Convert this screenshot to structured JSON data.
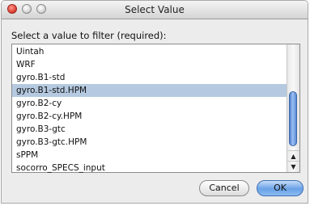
{
  "window": {
    "title": "Select Value"
  },
  "prompt": "Select a value to filter (required):",
  "list": {
    "items": [
      "Uintah",
      "WRF",
      "gyro.B1-std",
      "gyro.B1-std.HPM",
      "gyro.B2-cy",
      "gyro.B2-cy.HPM",
      "gyro.B3-gtc",
      "gyro.B3-gtc.HPM",
      "sPPM",
      "socorro_SPECS_input"
    ],
    "selected": "gyro.B1-std.HPM"
  },
  "buttons": {
    "cancel": "Cancel",
    "ok": "OK"
  },
  "colors": {
    "selection": "#b5c9e0",
    "accent": "#5a8ad6"
  }
}
